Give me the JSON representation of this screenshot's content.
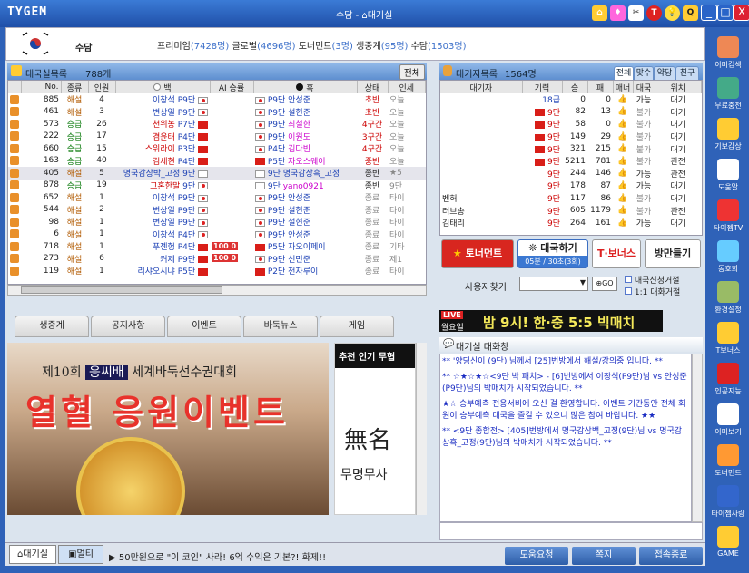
{
  "window": {
    "logo": "TYGEM",
    "title": "수담 - ⌂대기실",
    "buttons": [
      "_",
      "□",
      "X"
    ]
  },
  "user": {
    "name": "수담",
    "stats": [
      {
        "label": "프리미엄",
        "count": "(7428명)"
      },
      {
        "label": "글로벌",
        "count": "(4696명)"
      },
      {
        "label": "토너먼트",
        "count": "(3명)"
      },
      {
        "label": "생중계",
        "count": "(95명)"
      },
      {
        "label": "수담",
        "count": "(1503명)"
      }
    ]
  },
  "games_panel": {
    "title": "대국실목록",
    "count": "788개",
    "all_button": "전체",
    "columns": [
      "No.",
      "종류",
      "인원",
      "백",
      "AI 승률",
      "흑",
      "상태",
      "인세"
    ],
    "rows": [
      {
        "no": "885",
        "type": "해설",
        "people": "4",
        "white": "이창석",
        "wrank": "P9단",
        "wf": "kr",
        "ai": "",
        "black": "안성준",
        "bf": "kr",
        "brank": "P9단",
        "state": "초반",
        "x": "오늘"
      },
      {
        "no": "461",
        "type": "해설",
        "people": "3",
        "white": "변상일",
        "wrank": "P9단",
        "wf": "kr",
        "ai": "",
        "black": "설현준",
        "bf": "kr",
        "brank": "P9단",
        "state": "초반",
        "x": "오늘"
      },
      {
        "no": "573",
        "type": "승급",
        "people": "26",
        "white": "천위농",
        "wrank": "P7단",
        "wf": "cn",
        "ai": "",
        "black": "최철한",
        "bf": "kr",
        "brank": "P9단",
        "state": "4구간",
        "x": "오늘"
      },
      {
        "no": "222",
        "type": "승급",
        "people": "17",
        "white": "겸윤태",
        "wrank": "P4단",
        "wf": "cn",
        "ai": "",
        "black": "이원도",
        "bf": "kr",
        "brank": "P9단",
        "state": "3구간",
        "x": "오늘"
      },
      {
        "no": "660",
        "type": "승급",
        "people": "15",
        "white": "스위라이",
        "wrank": "P3단",
        "wf": "cn",
        "ai": "",
        "black": "김다빈",
        "bf": "kr",
        "brank": "P4단",
        "state": "4구간",
        "x": "오늘"
      },
      {
        "no": "163",
        "type": "승급",
        "people": "40",
        "white": "김세현",
        "wrank": "P4단",
        "wf": "cn",
        "ai": "",
        "black": "자오스웨이",
        "bf": "cn",
        "brank": "P5단",
        "state": "중반",
        "x": "오늘"
      },
      {
        "no": "405",
        "type": "해설",
        "people": "5",
        "white": "명국감상박_고정",
        "wrank": "9단",
        "wf": "jp",
        "ai": "",
        "black": "명국감상흑_고정",
        "bf": "jp",
        "brank": "9단",
        "state": "종반",
        "x": "★5"
      },
      {
        "no": "878",
        "type": "승급",
        "people": "19",
        "white": "그혼한말",
        "wrank": "9단",
        "wf": "kr",
        "ai": "",
        "black": "yano0921",
        "bf": "jp",
        "brank": "9단",
        "state": "종반",
        "x": "9단"
      },
      {
        "no": "652",
        "type": "해설",
        "people": "1",
        "white": "이창석",
        "wrank": "P9단",
        "wf": "kr",
        "ai": "",
        "black": "안성준",
        "bf": "kr",
        "brank": "P9단",
        "state": "종료",
        "x": "타이"
      },
      {
        "no": "544",
        "type": "해설",
        "people": "2",
        "white": "변상일",
        "wrank": "P9단",
        "wf": "kr",
        "ai": "",
        "black": "설현준",
        "bf": "kr",
        "brank": "P9단",
        "state": "종료",
        "x": "타이"
      },
      {
        "no": "98",
        "type": "해설",
        "people": "1",
        "white": "변상일",
        "wrank": "P9단",
        "wf": "kr",
        "ai": "",
        "black": "설현준",
        "bf": "kr",
        "brank": "P9단",
        "state": "종료",
        "x": "타이"
      },
      {
        "no": "6",
        "type": "해설",
        "people": "1",
        "white": "이창석",
        "wrank": "P4단",
        "wf": "kr",
        "ai": "",
        "black": "안성준",
        "bf": "kr",
        "brank": "P9단",
        "state": "종료",
        "x": "타이"
      },
      {
        "no": "718",
        "type": "해설",
        "people": "1",
        "white": "푸젠헝",
        "wrank": "P4단",
        "wf": "cn",
        "ai": "100 0",
        "black": "자오이페이",
        "bf": "cn",
        "brank": "P5단",
        "state": "종료",
        "x": "기타"
      },
      {
        "no": "273",
        "type": "해설",
        "people": "6",
        "white": "커제",
        "wrank": "P9단",
        "wf": "cn",
        "ai": "100 0",
        "black": "신민준",
        "bf": "kr",
        "brank": "P9단",
        "state": "종료",
        "x": "제1"
      },
      {
        "no": "119",
        "type": "해설",
        "people": "1",
        "white": "리샤오시냐",
        "wrank": "P5단",
        "wf": "cn",
        "ai": "",
        "black": "천자루이",
        "bf": "cn",
        "brank": "P2단",
        "state": "종료",
        "x": "타이"
      }
    ]
  },
  "bottom_tabs": [
    "생중계",
    "공지사항",
    "이벤트",
    "바둑뉴스",
    "게임"
  ],
  "banner": {
    "line1": "제10회",
    "cup": "응씨배",
    "line1b": "세계바둑선수권대회",
    "headline": "열혈 응원이벤트",
    "side_title": "추천 인기 무협",
    "side_text": "무명무사"
  },
  "players_panel": {
    "title": "대기자목록",
    "count": "1564명",
    "tabs": [
      "전체",
      "맞수",
      "약당",
      "친구"
    ],
    "columns": [
      "대기자",
      "기력",
      "승",
      "패",
      "매너",
      "대국",
      "위치"
    ],
    "rows": [
      {
        "name": "",
        "rank": "18급",
        "w": "0",
        "l": "0",
        "m": "good",
        "play": "가능",
        "loc": "대기"
      },
      {
        "name": "",
        "rank": "9단",
        "w": "82",
        "l": "13",
        "m": "good",
        "play": "불가",
        "loc": "대기"
      },
      {
        "name": "",
        "rank": "9단",
        "w": "58",
        "l": "0",
        "m": "good",
        "play": "불가",
        "loc": "대기"
      },
      {
        "name": "",
        "rank": "9단",
        "w": "149",
        "l": "29",
        "m": "good",
        "play": "불가",
        "loc": "대기"
      },
      {
        "name": "",
        "rank": "9단",
        "w": "321",
        "l": "215",
        "m": "good",
        "play": "불가",
        "loc": "대기"
      },
      {
        "name": "",
        "rank": "9단",
        "w": "5211",
        "l": "781",
        "m": "good",
        "play": "불가",
        "loc": "관전"
      },
      {
        "name": "",
        "rank": "9단",
        "w": "244",
        "l": "146",
        "m": "good",
        "play": "가능",
        "loc": "관전"
      },
      {
        "name": "",
        "rank": "9단",
        "w": "178",
        "l": "87",
        "m": "good",
        "play": "가능",
        "loc": "대기"
      },
      {
        "name": "벤허",
        "rank": "9단",
        "w": "117",
        "l": "86",
        "m": "good",
        "play": "불가",
        "loc": "대기"
      },
      {
        "name": "러브송",
        "rank": "9단",
        "w": "605",
        "l": "1179",
        "m": "good",
        "play": "불가",
        "loc": "관전"
      },
      {
        "name": "김태리",
        "rank": "9단",
        "w": "264",
        "l": "161",
        "m": "good",
        "play": "가능",
        "loc": "대기"
      }
    ]
  },
  "actions": {
    "tournament": "토너먼트",
    "match": "대국하기",
    "match_sub": "05분 / 30초(3회)",
    "bonus": "T·보너스",
    "enter": "방만들기",
    "search_label": "사용자찾기",
    "go": "GO",
    "opt1": "대국신청거절",
    "opt2": "1:1 대화거절"
  },
  "live": {
    "tag": "LIVE",
    "day": "월요일",
    "text": "밤 9시! 한·중 5:5 빅매치"
  },
  "chat": {
    "title": "대기실 대화창",
    "messages": [
      "** '양딩신이 (9단)'님께서 [25]번방에서 해설/강의중 입니다. **",
      "** ☆★☆★☆<9단 박 패치> - [6]번방에서 이창석(P9단)님 vs 안성준(P9단)님의 박매치가 시작되었습니다. **",
      "★☆ 승부예측 전용서비에 오신 걸 환영합니다. 이벤트 기간동안 전체 회원이 승부예측 대국을 즐길 수 있으니 많은 참여 바랍니다. ★★",
      "** <9단 종합전> [405]번방에서 명국감상백_고정(9단)님 vs 명국감상흑_고정(9단)님의 박매치가 시작되었습니다. **"
    ]
  },
  "bottom": {
    "tab1": "대기실",
    "tab2": "멀티",
    "ticker": "▶ 50만원으로 \"이 코인\" 사라! 6억 수익은 기본?! 화제!!",
    "help": "도움요청",
    "note": "쪽지",
    "exit": "접속종료"
  },
  "sidebar": [
    "이미검색",
    "무료충전",
    "기보감상",
    "도움말",
    "타이젬TV",
    "동호회",
    "환경설정",
    "T보너스",
    "인공지능",
    "이미보기",
    "토너먼트",
    "타이젬사랑",
    "GAME"
  ],
  "colors": {
    "accent": "#2f62b8",
    "red": "#cc0000",
    "blue": "#1a3fb4"
  }
}
